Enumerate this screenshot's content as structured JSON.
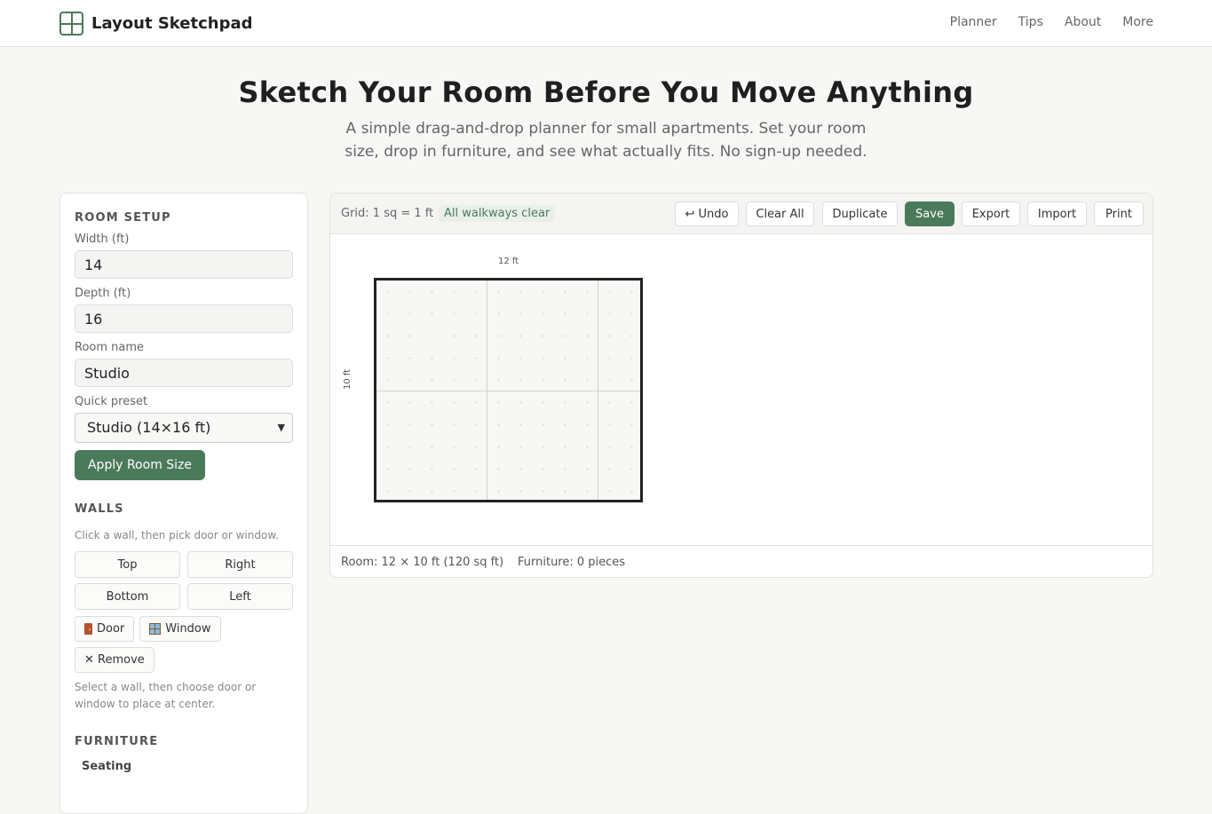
{
  "header": {
    "brand_icon": "grid-layout-icon",
    "title": "Layout Sketchpad",
    "nav": [
      "Planner",
      "Tips",
      "About",
      "More"
    ]
  },
  "hero": {
    "title": "Sketch Your Room Before You Move Anything",
    "subtitle": "A simple drag-and-drop planner for small apartments. Set your room size, drop in furniture, and see what actually fits. No sign-up needed."
  },
  "sidebar": {
    "room_setup": {
      "title": "ROOM SETUP",
      "width_label": "Width (ft)",
      "width_value": "14",
      "depth_label": "Depth (ft)",
      "depth_value": "16",
      "name_label": "Room name",
      "name_value": "Studio",
      "preset_label": "Quick preset",
      "preset_value": "Studio (14×16 ft)",
      "apply_label": "Apply Room Size"
    },
    "walls": {
      "title": "WALLS",
      "hint": "Click a wall, then pick door or window.",
      "buttons": [
        "Top",
        "Right",
        "Bottom",
        "Left"
      ],
      "door_label": "Door",
      "window_label": "Window",
      "remove_label": "✕ Remove",
      "help": "Select a wall, then choose door or window to place at center."
    },
    "furniture": {
      "title": "FURNITURE",
      "first_category": "Seating"
    }
  },
  "toolbar": {
    "grid_info": "Grid: 1 sq = 1 ft",
    "status": "All walkways clear",
    "undo": "↩ Undo",
    "clear_all": "Clear All",
    "duplicate": "Duplicate",
    "save": "Save",
    "export": "Export",
    "import": "Import",
    "print": "Print"
  },
  "canvas": {
    "width_label": "12 ft",
    "depth_label": "10 ft",
    "room_width_ft": 12,
    "room_depth_ft": 10
  },
  "footer": {
    "room_info": "Room: 12 × 10 ft (120 sq ft)",
    "furniture_info": "Furniture: 0 pieces"
  },
  "colors": {
    "accent": "#4a7a5a",
    "background": "#f7f7f5",
    "wall": "#222222"
  }
}
